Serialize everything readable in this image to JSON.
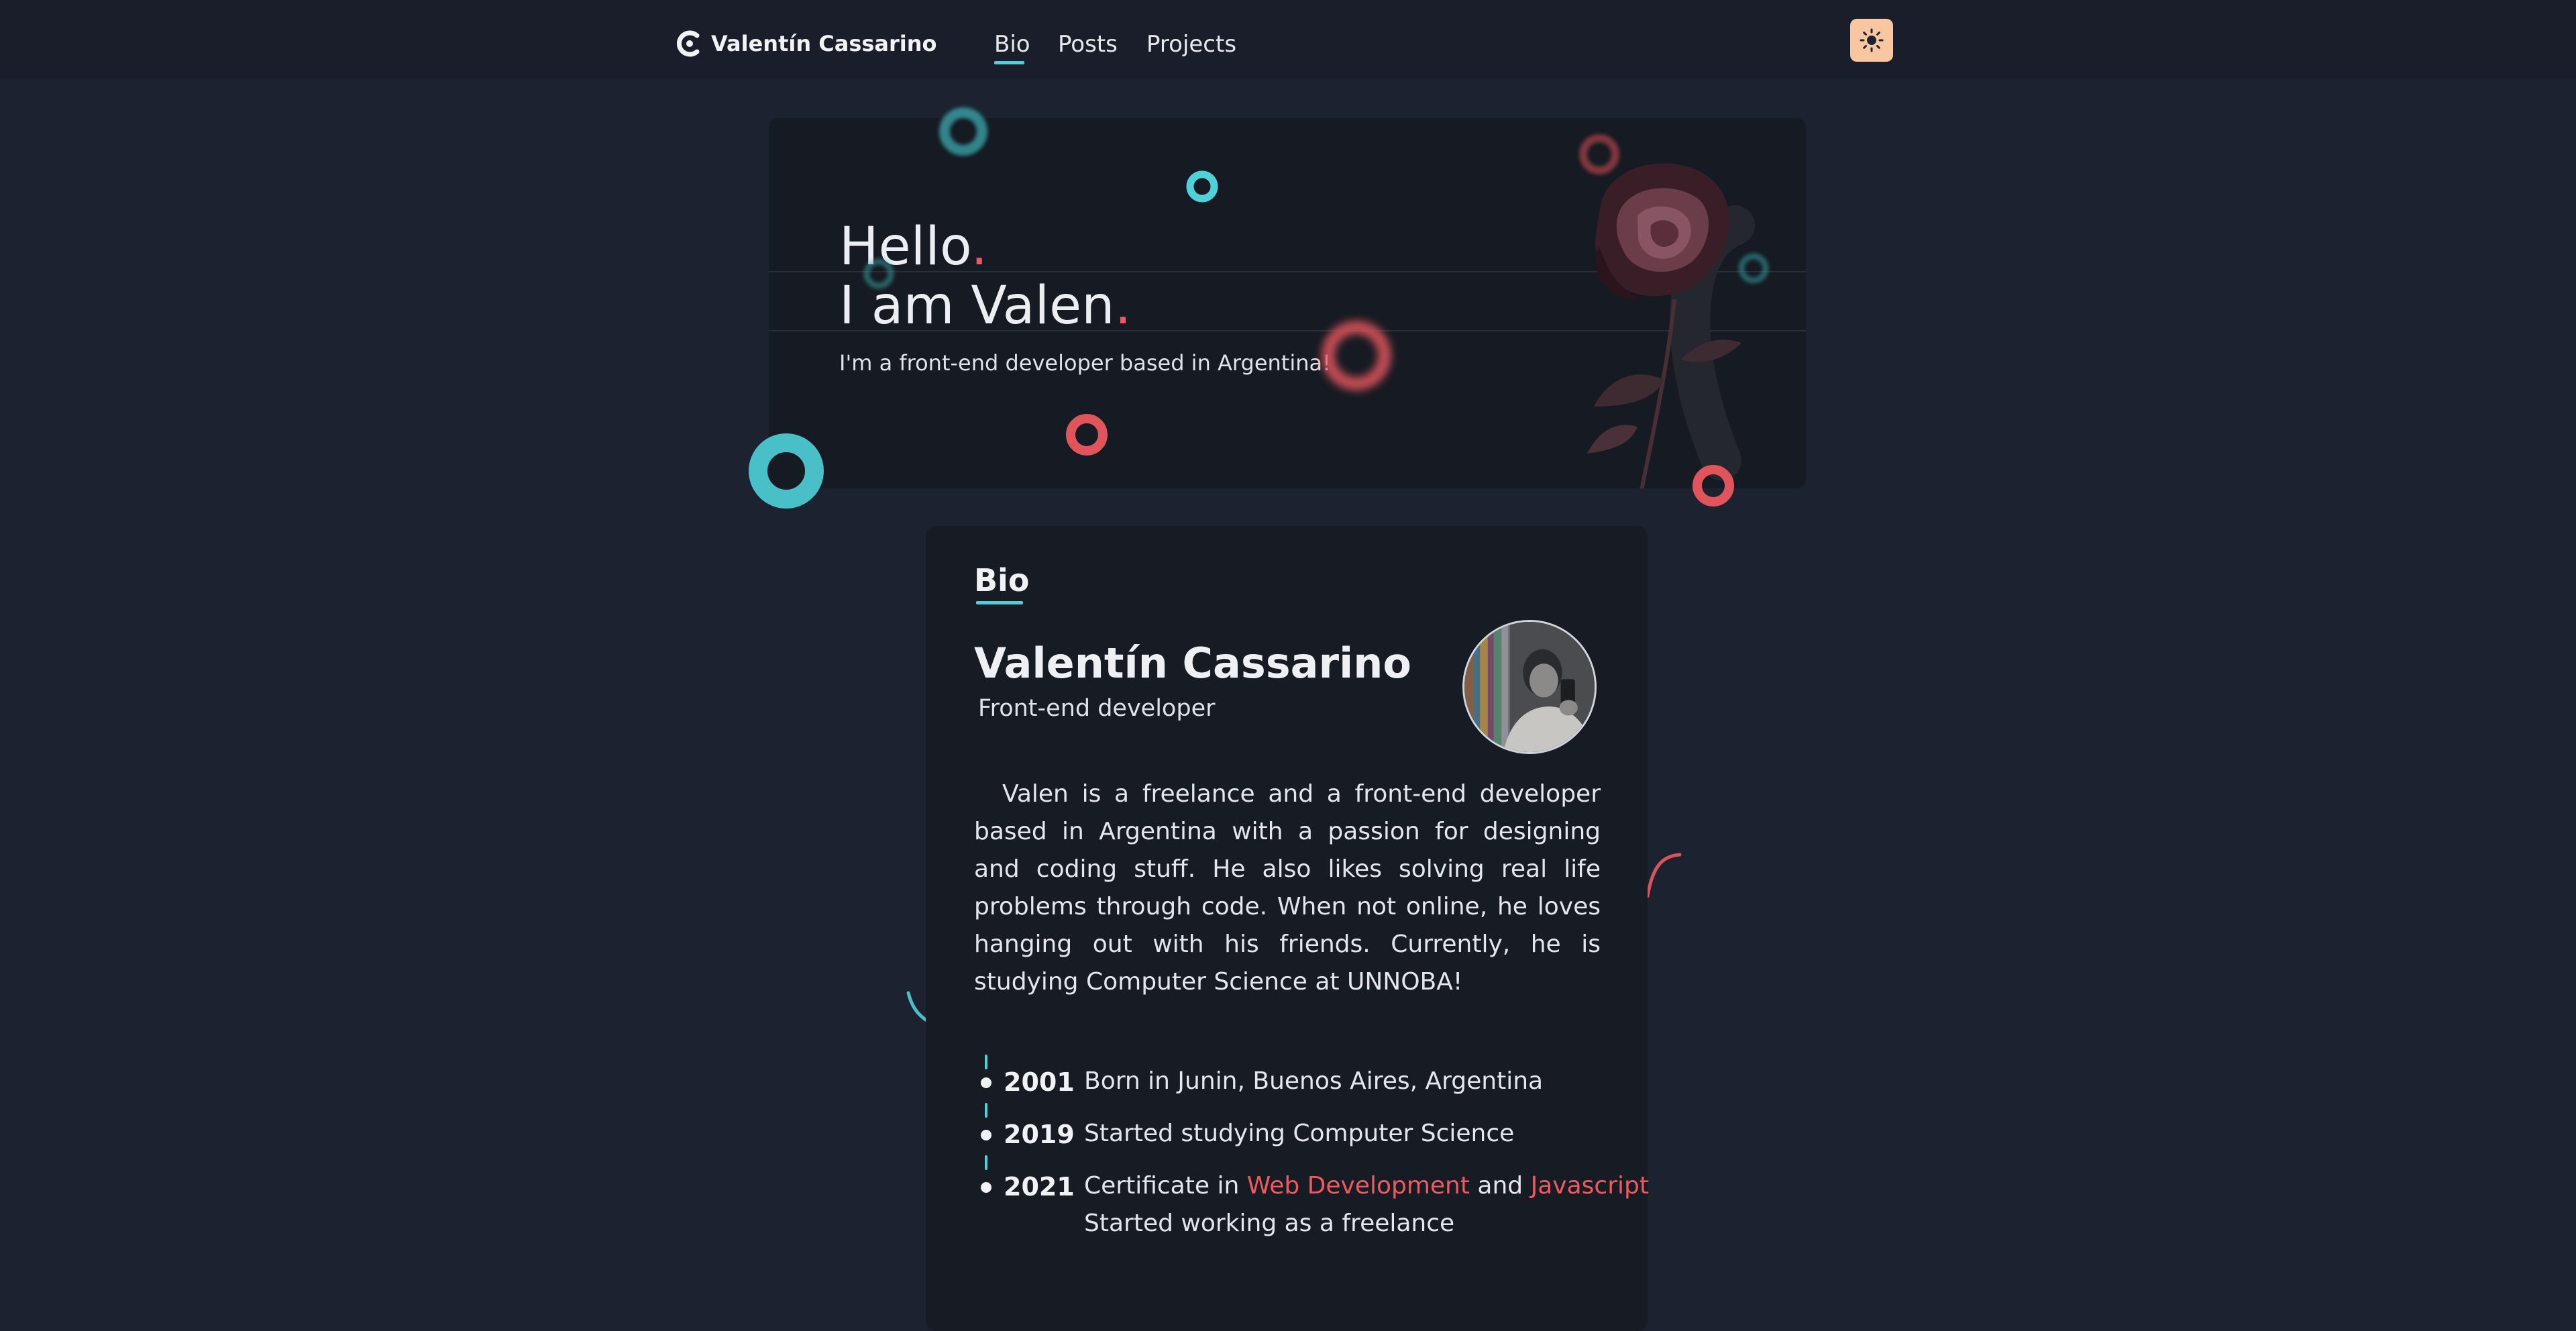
{
  "navbar": {
    "brand": "Valentín Cassarino",
    "links": [
      "Bio",
      "Posts",
      "Projects"
    ],
    "active_link": "Bio",
    "theme_toggle_icon": "sun-icon"
  },
  "hero": {
    "line1": "Hello",
    "line2": "I am Valen",
    "dot": ".",
    "subtitle": "I'm a front-end developer based in Argentina!",
    "image_icon": "rose-illustration"
  },
  "bio": {
    "heading": "Bio",
    "name": "Valentín Cassarino",
    "role": "Front-end developer",
    "avatar_icon": "profile-photo",
    "paragraph": "Valen is a freelance and a front-end developer based in Argentina with a passion for designing and coding stuff. He also likes solving real life problems through code. When not online, he loves hanging out with his friends. Currently, he is studying Computer Science at UNNOBA!",
    "timeline": [
      {
        "year": "2001",
        "text": "Born in Junin, Buenos Aires, Argentina"
      },
      {
        "year": "2019",
        "text": "Started studying Computer Science"
      },
      {
        "year": "2021",
        "prefix": "Certificate in ",
        "link1": "Web Development",
        "middle": " and ",
        "link2": "Javascript",
        "line2": "Started working as a freelance"
      }
    ]
  },
  "colors": {
    "background": "#1c2230",
    "navbar": "#191e2a",
    "card": "#171b24",
    "accent_cyan": "#4fd1d9",
    "accent_red": "#ef5a61",
    "theme_button": "#f8c6a0"
  }
}
